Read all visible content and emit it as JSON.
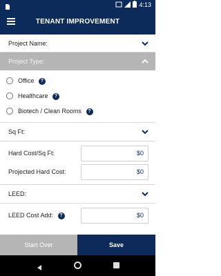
{
  "status_bar": {
    "time": "4:13"
  },
  "app_bar": {
    "title": "TENANT IMPROVEMENT"
  },
  "sections": {
    "project_name": "Project Name:",
    "project_type": "Project Type:",
    "sq_ft": "Sq Ft:",
    "leed": "LEED:"
  },
  "project_type_options": [
    {
      "label": "Office",
      "help": "?"
    },
    {
      "label": "Healthcare",
      "help": "?"
    },
    {
      "label": "Biotech / Clean Rooms",
      "help": "?"
    }
  ],
  "fields": {
    "hard_cost_sqft": {
      "label": "Hard Cost/Sq Ft:",
      "value": "$0"
    },
    "projected_hard_cost": {
      "label": "Projected Hard Cost:",
      "value": "$0"
    },
    "leed_cost_add": {
      "label": "LEED Cost Add:",
      "value": "$0",
      "help": "?"
    }
  },
  "buttons": {
    "start_over": "Start Over",
    "save": "Save"
  },
  "colors": {
    "primary": "#0c2a5a",
    "gray": "#b5b5b5"
  }
}
